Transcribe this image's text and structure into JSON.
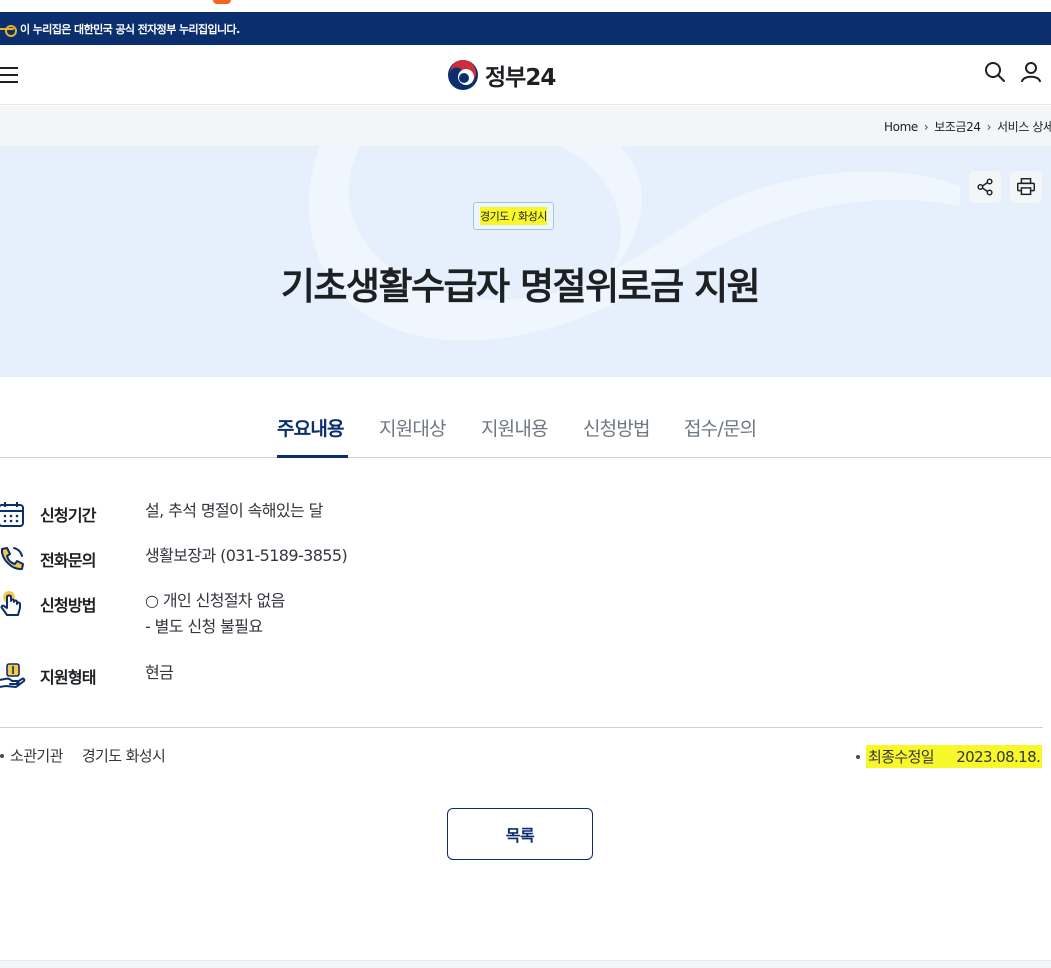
{
  "gov_banner": {
    "text": "이 누리집은 대한민국 공식 전자정부 누리집입니다."
  },
  "header": {
    "logo_text": "정부24"
  },
  "breadcrumb": {
    "items": [
      "Home",
      "보조금24",
      "서비스 상세"
    ]
  },
  "hero": {
    "region": "경기도 / 화성시",
    "title": "기초생활수급자 명절위로금 지원"
  },
  "tabs": [
    {
      "label": "주요내용",
      "active": true
    },
    {
      "label": "지원대상",
      "active": false
    },
    {
      "label": "지원내용",
      "active": false
    },
    {
      "label": "신청방법",
      "active": false
    },
    {
      "label": "접수/문의",
      "active": false
    }
  ],
  "info": {
    "period": {
      "label": "신청기간",
      "value": "설, 추석 명절이 속해있는 달"
    },
    "phone": {
      "label": "전화문의",
      "value": "생활보장과 (031-5189-3855)"
    },
    "method": {
      "label": "신청방법",
      "line1": "○ 개인 신청절차 없음",
      "line2": "- 별도 신청 불필요"
    },
    "form": {
      "label": "지원형태",
      "value": "현금"
    }
  },
  "meta": {
    "agency_label": "소관기관",
    "agency_value": "경기도 화성시",
    "updated_label": "최종수정일",
    "updated_value": "2023.08.18."
  },
  "buttons": {
    "list_label": "목록"
  },
  "colors": {
    "navy": "#0b2f6e",
    "hero_bg": "#e6f0fc",
    "highlight": "#f7f72a",
    "logo_red": "#cd2e3a",
    "logo_blue": "#0047a0"
  }
}
